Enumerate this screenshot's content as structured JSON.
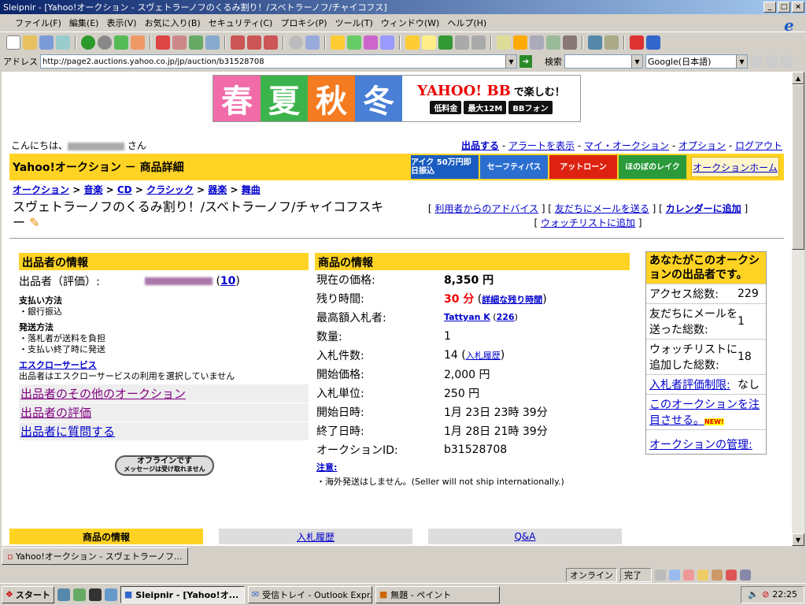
{
  "window": {
    "title": "Sleipnir - [Yahoo!オークション - スヴェトラーノフのくるみ割り！/スベトラーノフ/チャイコフス]"
  },
  "menu": [
    "ファイル(F)",
    "編集(E)",
    "表示(V)",
    "お気に入り(B)",
    "セキュリティ(C)",
    "プロキシ(P)",
    "ツール(T)",
    "ウィンドウ(W)",
    "ヘルプ(H)"
  ],
  "address": {
    "label": "アドレス",
    "url": "http://page2.auctions.yahoo.co.jp/jp/auction/b31528708",
    "search_label": "検索",
    "engine": "Google(日本語)"
  },
  "banner": {
    "seasons": [
      "春",
      "夏",
      "秋",
      "冬"
    ],
    "brand": "YAHOO! BB",
    "slogan": "で楽しむ！",
    "chips": [
      "低料金",
      "最大12M",
      "BBフォン"
    ]
  },
  "greeting": {
    "prefix": "こんにちは、",
    "suffix": "さん"
  },
  "toplinks": [
    "出品する",
    "アラートを表示",
    "マイ・オークション",
    "オプション",
    "ログアウト"
  ],
  "header": {
    "title": "Yahoo!オークション － 商品詳細",
    "home": "オークションホーム",
    "ads": [
      "アイク 50万円即日振込",
      "セーフティパス",
      "アットローン",
      "ほのぼのレイク"
    ]
  },
  "breadcrumb": [
    "オークション",
    "音楽",
    "CD",
    "クラシック",
    "器楽",
    "舞曲"
  ],
  "item": {
    "title": "スヴェトラーノフのくるみ割り！/スベトラーノフ/チャイコフスキー"
  },
  "actions": {
    "line1": [
      "利用者からのアドバイス",
      "友だちにメールを送る",
      "カレンダーに追加"
    ],
    "line2": "ウォッチリストに追加"
  },
  "seller": {
    "header": "出品者の情報",
    "label": "出品者（評価）:",
    "rating": "10",
    "pay_title": "支払い方法",
    "pay": "・銀行振込",
    "ship_title": "発送方法",
    "ship1": "・落札者が送料を負担",
    "ship2": "・支払い終了時に発送",
    "escrow": "エスクローサービス",
    "escrow_note": "出品者はエスクローサービスの利用を選択していません",
    "links": [
      "出品者のその他のオークション",
      "出品者の評価",
      "出品者に質問する"
    ],
    "offline1": "オフラインです",
    "offline2": "メッセージは受け取れません"
  },
  "product": {
    "header": "商品の情報",
    "rows": [
      {
        "k": "現在の価格:",
        "v": "8,350 円"
      },
      {
        "k": "残り時間:",
        "v": "30 分",
        "link": "詳細な残り時間"
      },
      {
        "k": "最高額入札者:",
        "v": "Tattyan K",
        "link": "226"
      },
      {
        "k": "数量:",
        "v": "1"
      },
      {
        "k": "入札件数:",
        "v": "14",
        "link": "入札履歴"
      },
      {
        "k": "開始価格:",
        "v": "2,000 円"
      },
      {
        "k": "入札単位:",
        "v": "250 円"
      },
      {
        "k": "開始日時:",
        "v": "1月 23日 23時 39分"
      },
      {
        "k": "終了日時:",
        "v": "1月 28日 21時 39分"
      },
      {
        "k": "オークションID:",
        "v": "b31528708"
      }
    ],
    "note_title": "注意:",
    "note": "・海外発送はしません。(Seller will not ship internationally.)"
  },
  "owner": {
    "header": "あなたがこのオークションの出品者です。",
    "stats": [
      {
        "k": "アクセス総数:",
        "v": "229"
      },
      {
        "k": "友だちにメールを送った総数:",
        "v": "1"
      },
      {
        "k": "ウォッチリストに追加した総数:",
        "v": "18"
      },
      {
        "k": "入札者評価制限:",
        "v": "なし"
      }
    ],
    "watch": "このオークションを注目させる。",
    "new": "NEW!",
    "manage": "オークションの管理:"
  },
  "tabs": [
    "商品の情報",
    "入札履歴",
    "Q&A"
  ],
  "statusbar": {
    "tab": "Yahoo!オークション - スヴェトラーノフ...",
    "online": "オンライン",
    "done": "完了"
  },
  "taskbar": {
    "start": "スタート",
    "tasks": [
      "Sleipnir - [Yahoo!オ...",
      "受信トレイ - Outlook Expr...",
      "無題 - ペイント"
    ],
    "clock": "22:25"
  }
}
